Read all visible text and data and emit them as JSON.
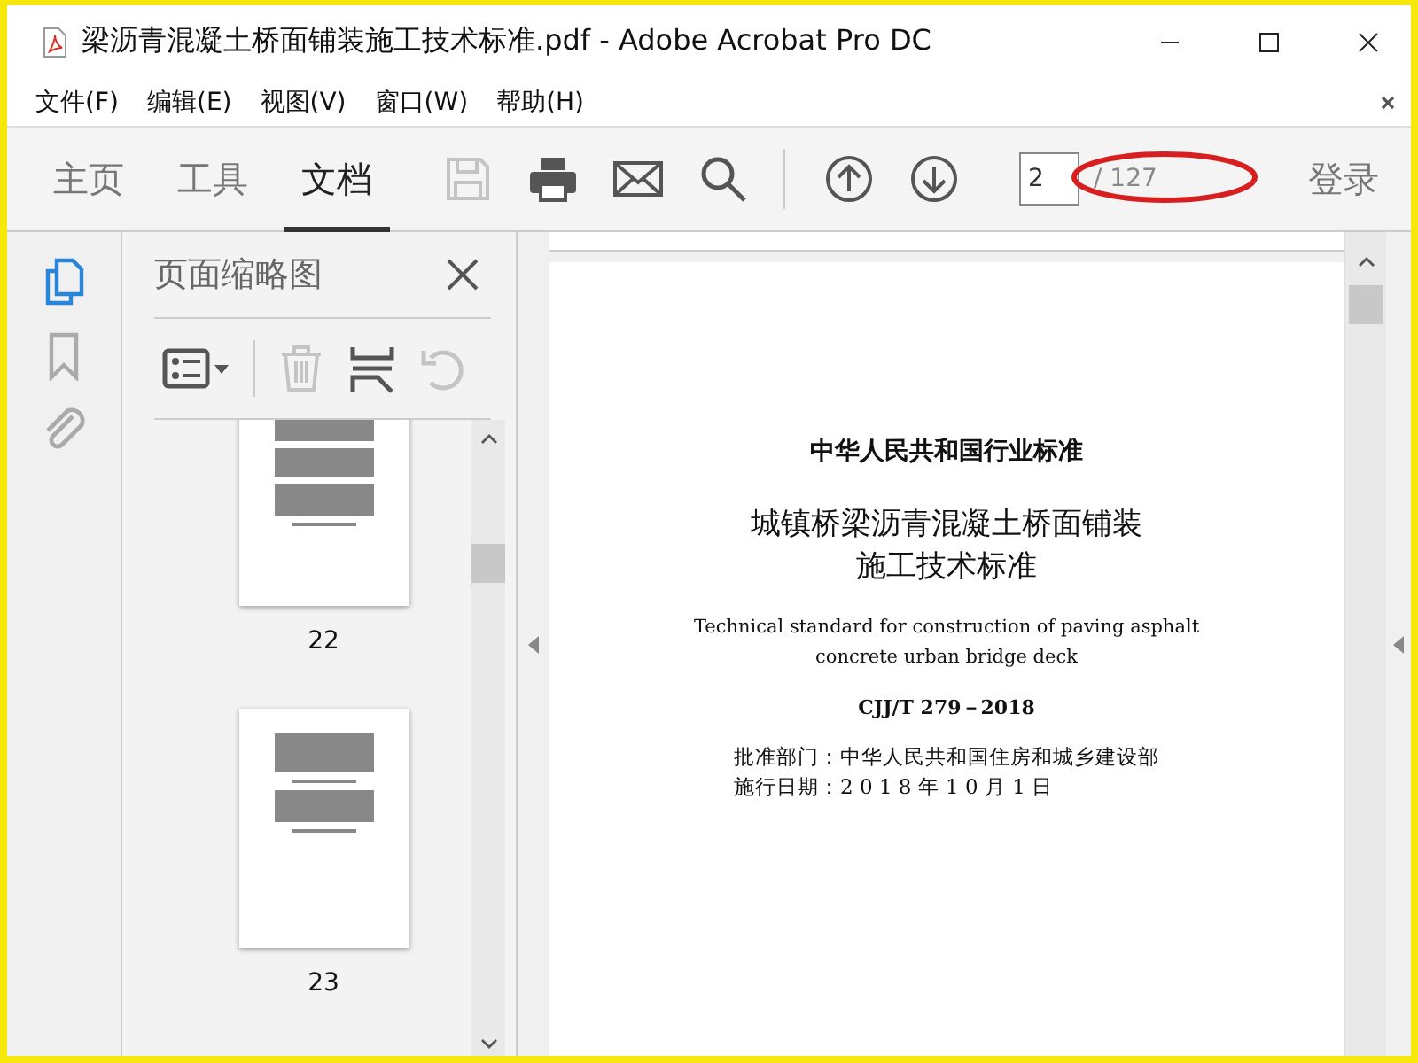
{
  "window": {
    "title": "梁沥青混凝土桥面铺装施工技术标准.pdf - Adobe Acrobat Pro DC"
  },
  "menu": [
    "文件(F)",
    "编辑(E)",
    "视图(V)",
    "窗口(W)",
    "帮助(H)"
  ],
  "tabs": [
    {
      "label": "主页",
      "selected": false
    },
    {
      "label": "工具",
      "selected": false
    },
    {
      "label": "文档",
      "selected": true
    }
  ],
  "tools": [
    {
      "kind": "save",
      "disabled": true
    },
    {
      "kind": "print",
      "disabled": false
    },
    {
      "kind": "mail",
      "disabled": false
    },
    {
      "kind": "search",
      "disabled": false
    },
    {
      "kind": "up",
      "disabled": false
    },
    {
      "kind": "down",
      "disabled": false
    }
  ],
  "page": {
    "value": "2",
    "total": "/ 127"
  },
  "sign_in": "登录",
  "rail": [
    {
      "kind": "pages",
      "selected": true
    },
    {
      "kind": "bookmark",
      "selected": false
    },
    {
      "kind": "attachment",
      "selected": false
    }
  ],
  "panel": {
    "title": "页面缩略图",
    "tools": [
      {
        "kind": "options",
        "disabled": false
      },
      {
        "kind": "delete",
        "disabled": true
      },
      {
        "kind": "insert",
        "disabled": false
      },
      {
        "kind": "rotate",
        "disabled": true
      }
    ],
    "thumbnails": [
      {
        "label": "22"
      },
      {
        "label": "23"
      }
    ]
  },
  "document": {
    "header": "中华人民共和国行业标准",
    "title": [
      "城镇桥梁沥青混凝土桥面铺装",
      "施工技术标准"
    ],
    "english": [
      "Technical standard for construction of paving asphalt",
      "concrete urban bridge deck"
    ],
    "code": "CJJ/T 279－2018",
    "approval": "批准部门：中华人民共和国住房和城乡建设部",
    "date": "施行日期：2 0 1 8 年 1 0 月 1 日"
  }
}
